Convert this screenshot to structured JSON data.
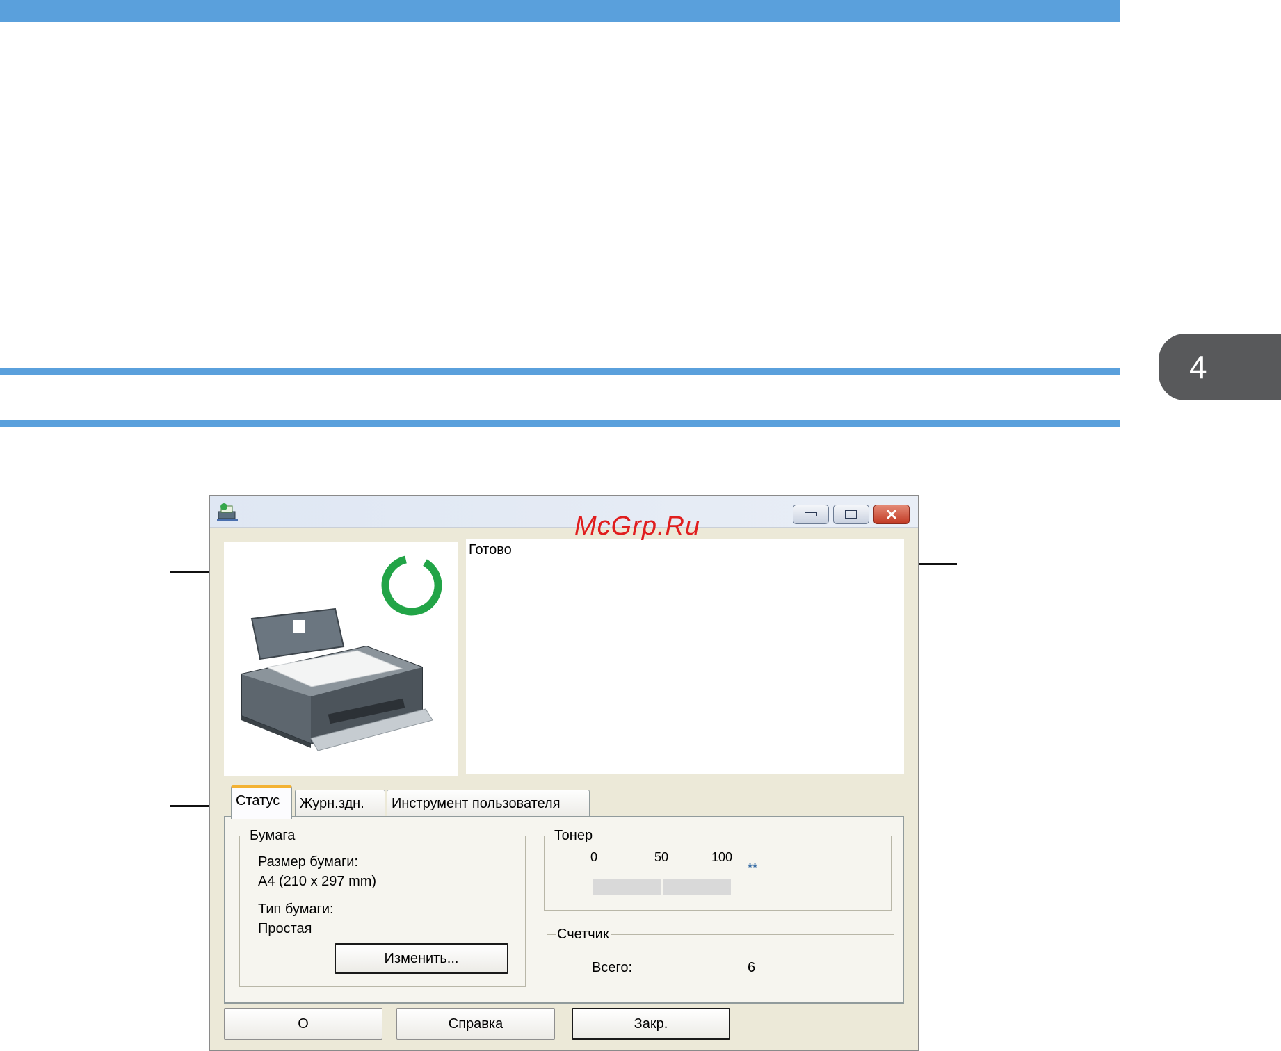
{
  "page": {
    "chapter_number": "4",
    "watermark": "McGrp.Ru"
  },
  "window": {
    "status_message": "Готово",
    "tabs": [
      {
        "label": "Статус",
        "active": true
      },
      {
        "label": "Журн.здн.",
        "active": false
      },
      {
        "label": "Инструмент пользователя",
        "active": false
      }
    ],
    "paper_group": {
      "title": "Бумага",
      "size_label": "Размер бумаги:",
      "size_value": "A4 (210 x 297 mm)",
      "type_label": "Тип бумаги:",
      "type_value": "Простая",
      "change_button": "Изменить..."
    },
    "toner_group": {
      "title": "Тонер",
      "scale": [
        "0",
        "50",
        "100"
      ],
      "level_text": "**"
    },
    "counter_group": {
      "title": "Счетчик",
      "total_label": "Всего:",
      "total_value": "6"
    },
    "buttons": {
      "about": "О",
      "help": "Справка",
      "close": "Закр."
    }
  }
}
